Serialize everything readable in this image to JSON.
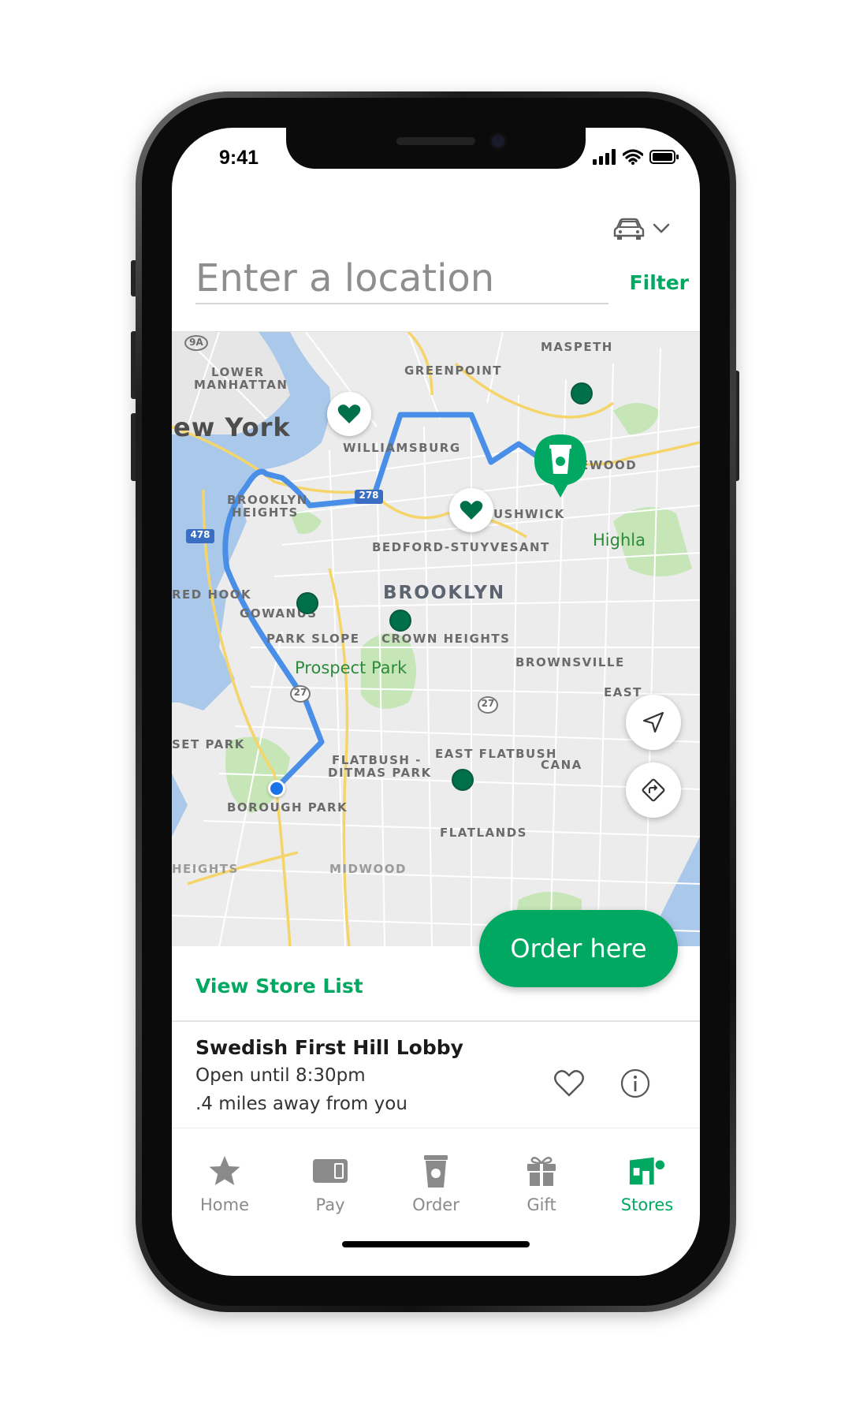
{
  "status_bar": {
    "time": "9:41"
  },
  "header": {
    "search_placeholder": "Enter a location",
    "filter_label": "Filter",
    "mode_icon": "car-icon"
  },
  "map": {
    "labels": {
      "route_9a": "9A",
      "lower_manhattan_1": "LOWER",
      "lower_manhattan_2": "MANHATTAN",
      "new_york": "ew York",
      "greenpoint": "GREENPOINT",
      "maspeth": "MASPETH",
      "williamsburg": "WILLIAMSBURG",
      "ridgewood": "EWOOD",
      "brooklyn_heights_1": "BROOKLYN",
      "brooklyn_heights_2": "HEIGHTS",
      "bushwick": "USHWICK",
      "route_278": "278",
      "route_478": "478",
      "bedford": "BEDFORD-STUYVESANT",
      "highland": "Highla",
      "red_hook": "RED HOOK",
      "brooklyn": "BROOKLYN",
      "gowanus": "GOWANUS",
      "park_slope": "PARK SLOPE",
      "crown_heights": "CROWN HEIGHTS",
      "prospect_park": "Prospect Park",
      "brownsville": "BROWNSVILLE",
      "east": "EAST",
      "route_27a": "27",
      "route_27b": "27",
      "sunset_park": "SET PARK",
      "flatbush_1": "FLATBUSH -",
      "flatbush_2": "DITMAS PARK",
      "east_flatbush": "EAST FLATBUSH",
      "canarsie": "CANA",
      "borough_park": "BOROUGH PARK",
      "flatlands": "FLATLANDS",
      "heights_cut": "HEIGHTS",
      "midwood": "MIDWOOD"
    }
  },
  "actions": {
    "order_here": "Order here",
    "view_store_list": "View Store List"
  },
  "store": {
    "name": "Swedish First Hill Lobby",
    "hours": "Open until 8:30pm",
    "distance": ".4 miles away from you"
  },
  "tabs": [
    {
      "label": "Home",
      "icon": "star-icon"
    },
    {
      "label": "Pay",
      "icon": "card-icon"
    },
    {
      "label": "Order",
      "icon": "cup-icon"
    },
    {
      "label": "Gift",
      "icon": "gift-icon"
    },
    {
      "label": "Stores",
      "icon": "store-icon",
      "active": true
    }
  ],
  "colors": {
    "accent": "#00a862",
    "pin_dark": "#00704a",
    "route": "#4a8fe7",
    "water": "#aac8ea",
    "park": "#c6e6b8"
  }
}
